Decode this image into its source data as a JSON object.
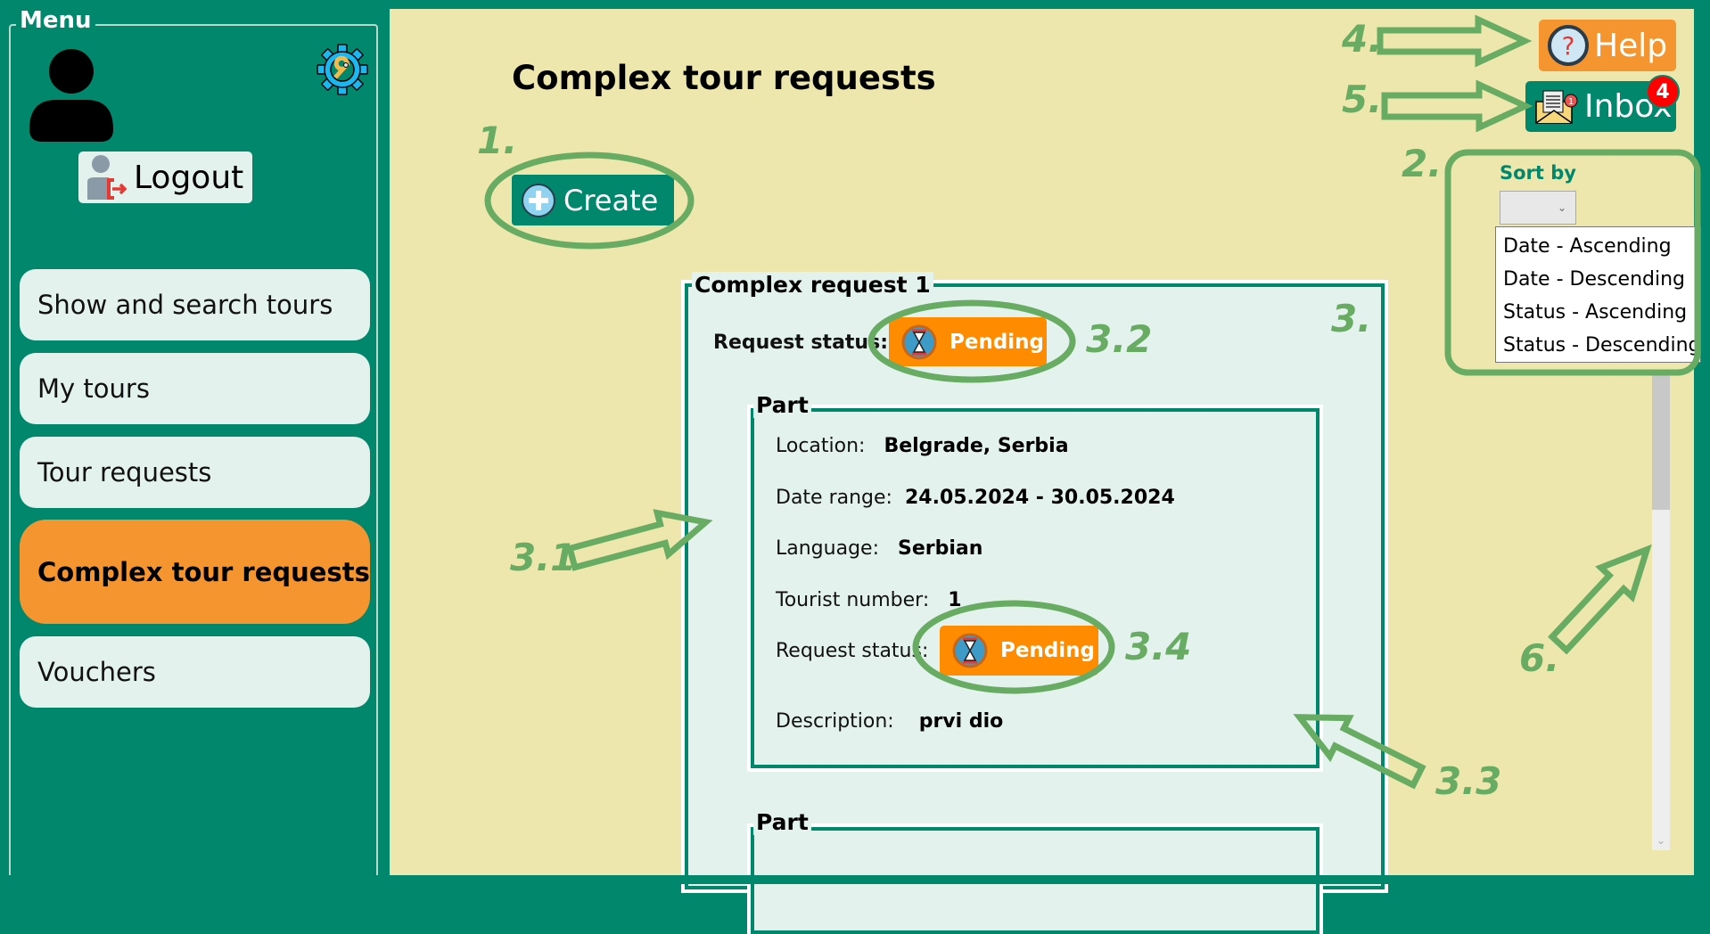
{
  "sidebar": {
    "legend": "Menu",
    "logout_label": "Logout",
    "items": [
      {
        "label": "Show and search tours",
        "active": false
      },
      {
        "label": "My tours",
        "active": false
      },
      {
        "label": "Tour requests",
        "active": false
      },
      {
        "label": "Complex tour requests",
        "active": true
      },
      {
        "label": "Vouchers",
        "active": false
      }
    ]
  },
  "header": {
    "title": "Complex tour requests",
    "create_label": "Create",
    "help_label": "Help",
    "inbox_label": "Inbox",
    "inbox_count": "4",
    "inbox_icon_count": "1"
  },
  "sort": {
    "label": "Sort by",
    "selected": "",
    "options": [
      "Date - Ascending",
      "Date - Descending",
      "Status - Ascending",
      "Status - Descending"
    ]
  },
  "requests": [
    {
      "title": "Complex request 1",
      "status_label": "Request status:",
      "status": "Pending",
      "parts": [
        {
          "title": "Part",
          "location_label": "Location:",
          "location": "Belgrade, Serbia",
          "date_label": "Date range:",
          "date_range": "24.05.2024 - 30.05.2024",
          "language_label": "Language:",
          "language": "Serbian",
          "tourists_label": "Tourist number:",
          "tourists": "1",
          "status_label": "Request status:",
          "status": "Pending",
          "description_label": "Description:",
          "description": "prvi dio"
        },
        {
          "title": "Part"
        }
      ]
    }
  ],
  "annotations": [
    "1.",
    "2.",
    "3.",
    "3.1",
    "3.2",
    "3.3",
    "3.4",
    "4.",
    "5.",
    "6."
  ],
  "colors": {
    "primary": "#00876c",
    "background": "#ede7ad",
    "accent": "#f5952f",
    "pending": "#ff8c00",
    "annotation": "#68ac64"
  }
}
